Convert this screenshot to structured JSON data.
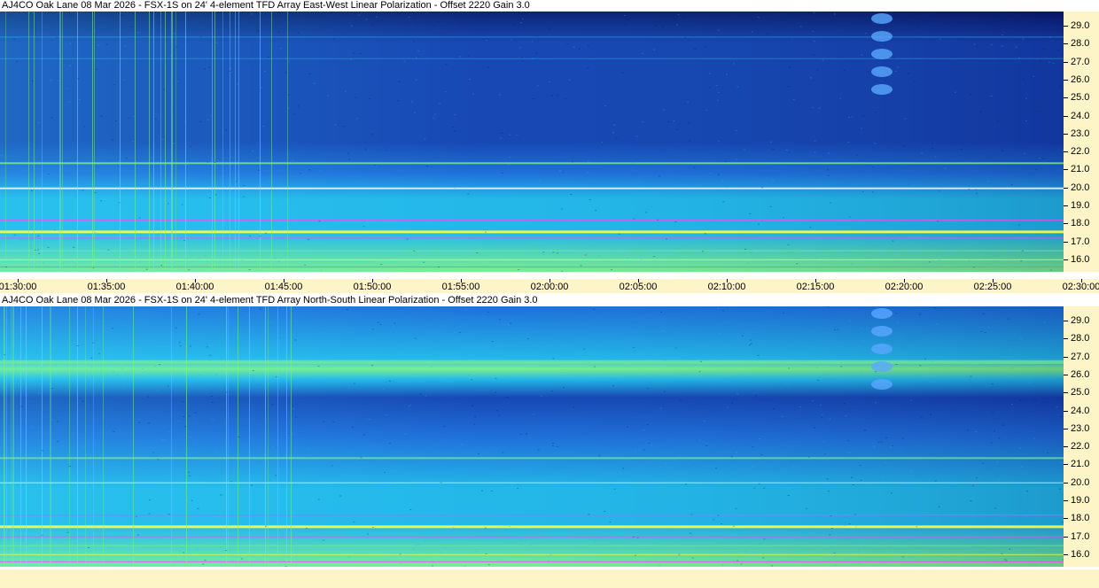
{
  "chart_data": [
    {
      "type": "heatmap",
      "title": "AJ4CO Oak Lane 08 Mar 2026 - FSX-1S on 24' 4-element TFD Array East-West Linear Polarization  -  Offset 2220  Gain 3.0",
      "y_tick_labels": [
        "29.0",
        "28.0",
        "27.0",
        "26.0",
        "25.0",
        "24.0",
        "23.0",
        "22.0",
        "21.0",
        "20.0",
        "19.0",
        "18.0",
        "17.0",
        "16.0"
      ],
      "ylim": [
        15.3,
        29.8
      ],
      "x_tick_labels": [
        "01:30:00",
        "01:35:00",
        "01:40:00",
        "01:45:00",
        "01:50:00",
        "01:55:00",
        "02:00:00",
        "02:05:00",
        "02:10:00",
        "02:15:00",
        "02:20:00",
        "02:25:00",
        "02:30:00"
      ],
      "xlim": [
        "01:30:00",
        "02:30:00"
      ],
      "color_scale": [
        "#0a1a6e",
        "#1540b0",
        "#1e6ad8",
        "#22b6e8",
        "#7ef08a",
        "#ffff40",
        "#ff40ff"
      ]
    },
    {
      "type": "heatmap",
      "title": "AJ4CO Oak Lane 08 Mar 2026 - FSX-1S on 24' 4-element TFD Array North-South Linear Polarization  -  Offset 2220  Gain 3.0",
      "y_tick_labels": [
        "29.0",
        "28.0",
        "27.0",
        "26.0",
        "25.0",
        "24.0",
        "23.0",
        "22.0",
        "21.0",
        "20.0",
        "19.0",
        "18.0",
        "17.0",
        "16.0"
      ],
      "ylim": [
        15.3,
        29.8
      ],
      "x_tick_labels": [],
      "xlim": [
        "01:30:00",
        "02:30:00"
      ],
      "color_scale": [
        "#0a1a6e",
        "#1540b0",
        "#1e6ad8",
        "#22b6e8",
        "#7ef08a",
        "#ffff40",
        "#ff40ff"
      ]
    }
  ]
}
